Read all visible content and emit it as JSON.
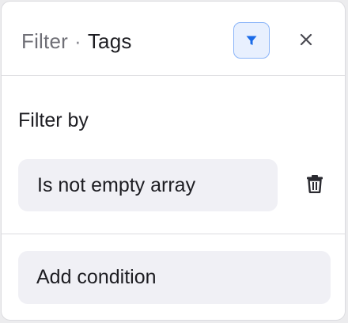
{
  "header": {
    "filter_word": "Filter",
    "separator": "·",
    "field_name": "Tags",
    "filter_toggle_icon": "funnel-icon",
    "close_icon": "close-icon"
  },
  "body": {
    "section_label": "Filter by",
    "conditions": [
      {
        "label": "Is not empty array",
        "delete_icon": "trash-icon"
      }
    ]
  },
  "footer": {
    "add_condition_label": "Add condition"
  },
  "colors": {
    "accent": "#1a6be8",
    "accent_bg": "#e8f0fe",
    "accent_border": "#8ab4f8",
    "pill_bg": "#f0f0f5",
    "text_primary": "#1d1d22",
    "text_secondary": "#6f6f76",
    "divider": "#dcdce0"
  }
}
